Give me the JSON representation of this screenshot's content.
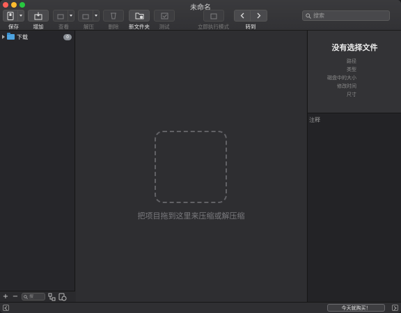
{
  "window": {
    "title": "未命名"
  },
  "toolbar": {
    "save": "保存",
    "add": "增加",
    "view": "查看",
    "extract": "解压",
    "delete": "删除",
    "new_folder": "新文件夹",
    "test": "测试",
    "run_now": "立即执行模式",
    "goto": "转到",
    "search_placeholder": "搜索"
  },
  "sidebar": {
    "items": [
      {
        "label": "下载",
        "badge": "0"
      }
    ],
    "filter_placeholder": "搜"
  },
  "main": {
    "drop_hint": "把项目拖到这里来压缩或解压缩"
  },
  "info": {
    "title": "没有选择文件",
    "fields": [
      "路径",
      "类型",
      "磁盘中的大小",
      "修改时间",
      "尺寸"
    ]
  },
  "notes": {
    "label": "注释"
  },
  "statusbar": {
    "buy_label": "今天就购买！"
  },
  "colors": {
    "accent_folder": "#4da3e0",
    "close": "#fc5f57",
    "minimize": "#fdbc2e",
    "zoom": "#28c840"
  }
}
